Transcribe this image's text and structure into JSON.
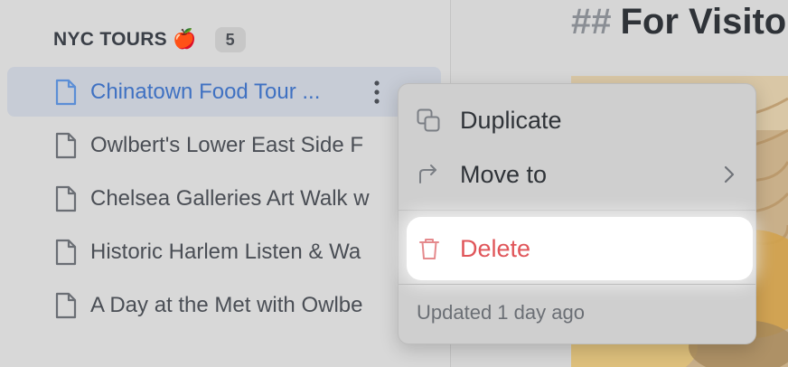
{
  "sidebar": {
    "section_title": "NYC TOURS 🍎",
    "count": "5",
    "pages": [
      {
        "label": "Chinatown Food Tour ...",
        "active": true
      },
      {
        "label": "Owlbert's Lower East Side F"
      },
      {
        "label": "Chelsea Galleries Art Walk w"
      },
      {
        "label": "Historic Harlem Listen & Wa"
      },
      {
        "label": "A Day at the Met with Owlbe"
      }
    ]
  },
  "main": {
    "heading_hash": "##",
    "heading_text": "For Visito"
  },
  "context_menu": {
    "duplicate": "Duplicate",
    "move_to": "Move to",
    "delete": "Delete",
    "footer": "Updated 1 day ago"
  },
  "colors": {
    "active_link": "#3f71c2",
    "delete": "#e0565a",
    "active_bg": "#c7ccd6"
  },
  "icons": [
    "page-icon",
    "more-vertical-icon",
    "duplicate-icon",
    "move-arrow-icon",
    "chevron-right-icon",
    "trash-icon"
  ]
}
